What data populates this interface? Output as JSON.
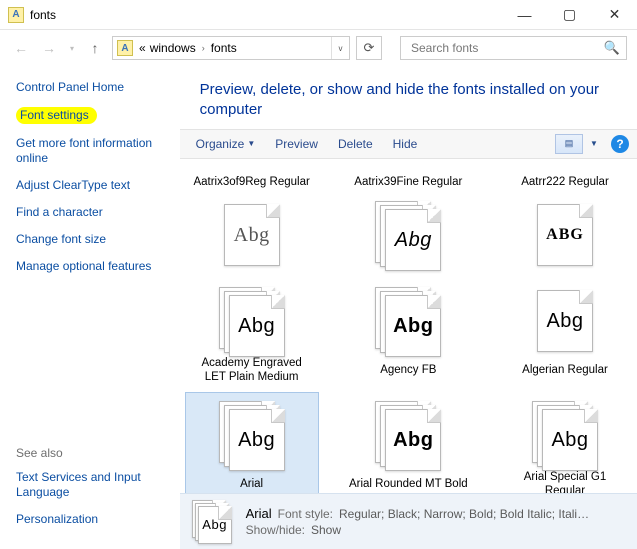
{
  "window": {
    "title": "fonts"
  },
  "address": {
    "prefix": "«",
    "crumbs": [
      "windows",
      "fonts"
    ]
  },
  "search": {
    "placeholder": "Search fonts"
  },
  "sidebar": {
    "items": [
      {
        "label": "Control Panel Home"
      },
      {
        "label": "Font settings",
        "highlight": true
      },
      {
        "label": "Get more font information online"
      },
      {
        "label": "Adjust ClearType text"
      },
      {
        "label": "Find a character"
      },
      {
        "label": "Change font size"
      },
      {
        "label": "Manage optional features"
      }
    ],
    "see_also_head": "See also",
    "see_also": [
      {
        "label": "Text Services and Input Language"
      },
      {
        "label": "Personalization"
      }
    ]
  },
  "heading": "Preview, delete, or show and hide the fonts installed on your computer",
  "toolbar": {
    "organize": "Organize",
    "preview": "Preview",
    "delete": "Delete",
    "hide": "Hide",
    "help": "?"
  },
  "fonts": {
    "row1": [
      {
        "label": "Aatrix3of9Reg Regular",
        "glyph": "Abg",
        "style": "serif-lt",
        "stack": false
      },
      {
        "label": "Aatrix39Fine Regular",
        "glyph": "Abg",
        "style": "cond",
        "stack": true
      },
      {
        "label": "Aatrr222 Regular",
        "glyph": "ABG",
        "style": "deco-caps",
        "stack": false
      }
    ],
    "row2": [
      {
        "label": "Academy Engraved LET Plain Medium",
        "glyph": "Abg",
        "style": "sans",
        "stack": true
      },
      {
        "label": "Agency FB",
        "glyph": "Abg",
        "style": "sans-bold",
        "stack": true
      },
      {
        "label": "Algerian Regular",
        "glyph": "Abg",
        "style": "sans-reg",
        "stack": false
      }
    ],
    "row3": [
      {
        "label": "Arial",
        "glyph": "Abg",
        "style": "sans",
        "stack": true,
        "selected": true
      },
      {
        "label": "Arial Rounded MT Bold",
        "glyph": "Abg",
        "style": "sans-bold",
        "stack": true
      },
      {
        "label": "Arial Special G1 Regular",
        "glyph": "Abg",
        "style": "sans-reg",
        "stack": true
      }
    ]
  },
  "details": {
    "name": "Arial",
    "font_style_key": "Font style:",
    "font_style_val": "Regular; Black; Narrow; Bold; Bold Italic; Itali…",
    "showhide_key": "Show/hide:",
    "showhide_val": "Show"
  }
}
